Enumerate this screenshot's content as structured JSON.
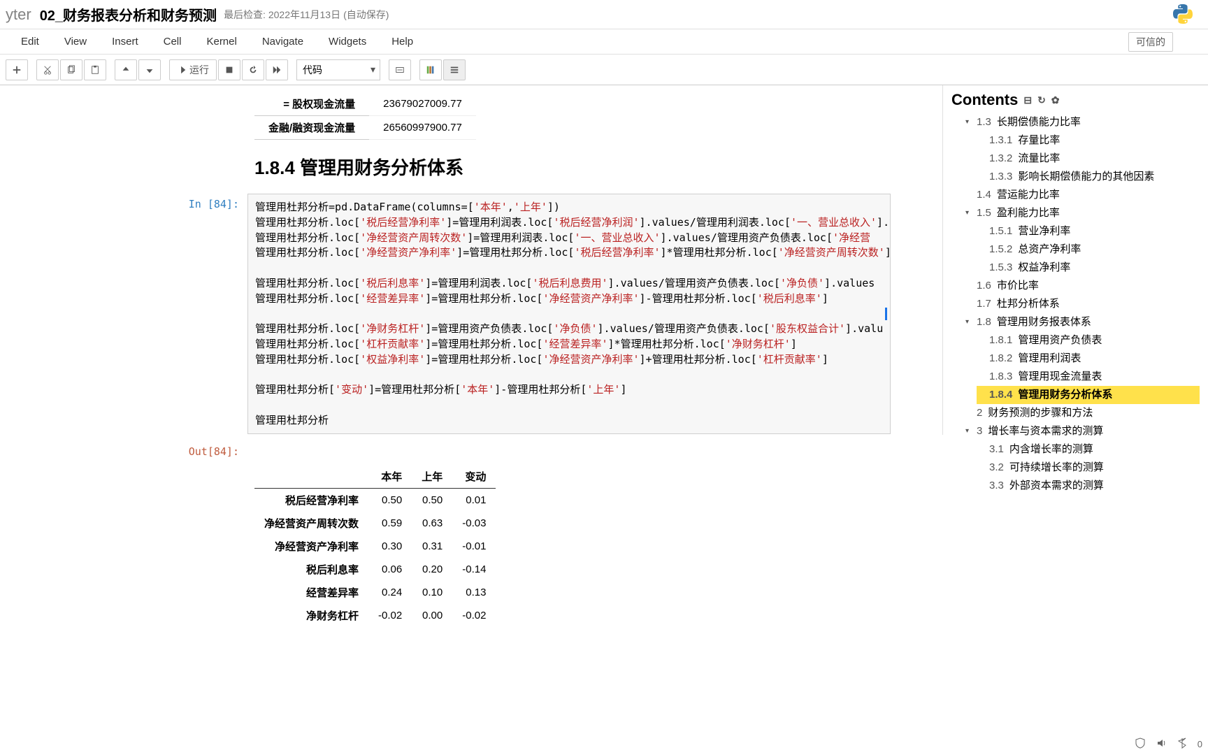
{
  "header": {
    "logo": "yter",
    "title": "02_财务报表分析和财务预测",
    "last_checkpoint": "最后检查: 2022年11月13日",
    "autosave": "(自动保存)"
  },
  "menubar": {
    "items": [
      "Edit",
      "View",
      "Insert",
      "Cell",
      "Kernel",
      "Navigate",
      "Widgets",
      "Help"
    ],
    "trusted": "可信的"
  },
  "toolbar": {
    "run": "运行",
    "cell_type": "代码"
  },
  "top_table": {
    "rows": [
      {
        "label": "= 股权现金流量",
        "value": "23679027009.77"
      },
      {
        "label": "金融/融资现金流量",
        "value": "26560997900.77"
      }
    ]
  },
  "markdown": {
    "heading": "1.8.4  管理用财务分析体系"
  },
  "code_cell": {
    "in_prompt": "In  [84]:",
    "out_prompt": "Out[84]:",
    "code_tokens": {
      "py_df": "pd.DataFrame",
      "cols": "columns",
      "loc": ".loc[",
      "vals": "].values",
      "s_curr": "'本年'",
      "s_prev": "'上年'",
      "s_tax_op_rate": "'税后经营净利率'",
      "s_tax_op_profit": "'税后经营净利润'",
      "s_rev": "'一、营业总收入'",
      "s_asset_turn": "'净经营资产周转次数'",
      "s_asset_return": "'净经营资产净利率'",
      "s_after_tax_int": "'税后利息费用'",
      "s_tax_int_rate": "'税后利息率'",
      "s_net_debt": "'净负债'",
      "s_op_diff": "'经营差异率'",
      "s_equity": "'股东权益合计'",
      "s_fin_lev": "'净财务杠杆'",
      "s_lev_contrib": "'杠杆贡献率'",
      "s_roe": "'权益净利率'",
      "s_change": "'变动'",
      "s_net_op_asset": "'净经营"
    },
    "var_du": "管理用杜邦分析",
    "var_profit": "管理用利润表",
    "var_bs": "管理用资产负债表"
  },
  "out_table": {
    "headers": [
      "本年",
      "上年",
      "变动"
    ],
    "rows": [
      {
        "label": "税后经营净利率",
        "v1": "0.50",
        "v2": "0.50",
        "v3": "0.01"
      },
      {
        "label": "净经营资产周转次数",
        "v1": "0.59",
        "v2": "0.63",
        "v3": "-0.03"
      },
      {
        "label": "净经营资产净利率",
        "v1": "0.30",
        "v2": "0.31",
        "v3": "-0.01"
      },
      {
        "label": "税后利息率",
        "v1": "0.06",
        "v2": "0.20",
        "v3": "-0.14"
      },
      {
        "label": "经营差异率",
        "v1": "0.24",
        "v2": "0.10",
        "v3": "0.13"
      },
      {
        "label": "净财务杠杆",
        "v1": "-0.02",
        "v2": "0.00",
        "v3": "-0.02"
      }
    ]
  },
  "toc": {
    "title": "Contents",
    "items": [
      {
        "num": "1.3",
        "label": "长期偿债能力比率",
        "expanded": true,
        "children": [
          {
            "num": "1.3.1",
            "label": "存量比率"
          },
          {
            "num": "1.3.2",
            "label": "流量比率"
          },
          {
            "num": "1.3.3",
            "label": "影响长期偿债能力的其他因素"
          }
        ]
      },
      {
        "num": "1.4",
        "label": "营运能力比率"
      },
      {
        "num": "1.5",
        "label": "盈利能力比率",
        "expanded": true,
        "children": [
          {
            "num": "1.5.1",
            "label": "营业净利率"
          },
          {
            "num": "1.5.2",
            "label": "总资产净利率"
          },
          {
            "num": "1.5.3",
            "label": "权益净利率"
          }
        ]
      },
      {
        "num": "1.6",
        "label": "市价比率"
      },
      {
        "num": "1.7",
        "label": "杜邦分析体系"
      },
      {
        "num": "1.8",
        "label": "管理用财务报表体系",
        "expanded": true,
        "children": [
          {
            "num": "1.8.1",
            "label": "管理用资产负债表"
          },
          {
            "num": "1.8.2",
            "label": "管理用利润表"
          },
          {
            "num": "1.8.3",
            "label": "管理用现金流量表"
          },
          {
            "num": "1.8.4",
            "label": "管理用财务分析体系",
            "active": true
          }
        ]
      },
      {
        "num": "2",
        "label": "财务预测的步骤和方法"
      },
      {
        "num": "3",
        "label": "增长率与资本需求的测算",
        "expanded": true,
        "children": [
          {
            "num": "3.1",
            "label": "内含增长率的测算"
          },
          {
            "num": "3.2",
            "label": "可持续增长率的测算"
          },
          {
            "num": "3.3",
            "label": "外部资本需求的测算"
          }
        ]
      }
    ]
  },
  "systray": {
    "time_label": "0"
  }
}
